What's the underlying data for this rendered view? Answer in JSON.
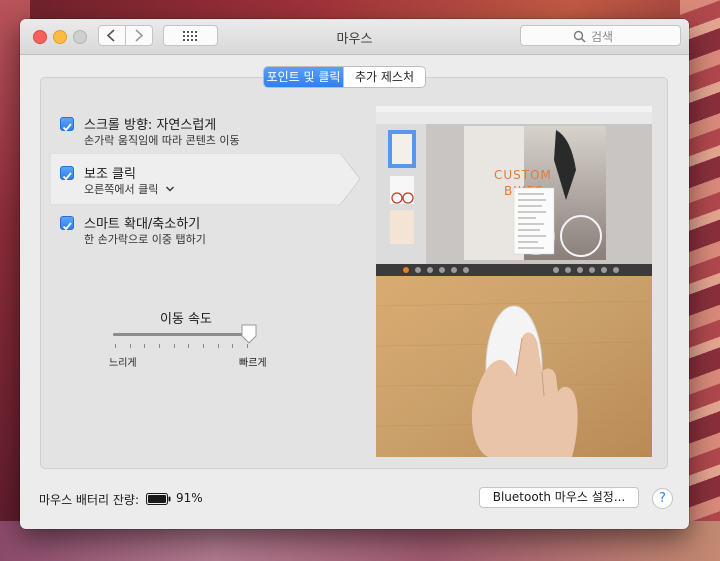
{
  "window": {
    "title": "마우스",
    "search_placeholder": "검색"
  },
  "tabs": [
    {
      "label": "포인트 및 클릭",
      "active": true
    },
    {
      "label": "추가 제스처",
      "active": false
    }
  ],
  "options": [
    {
      "title": "스크롤 방향: 자연스럽게",
      "subtitle": "손가락 움직임에 따라 콘텐츠 이동",
      "checked": true
    },
    {
      "title": "보조 클릭",
      "subtitle": "오른쪽에서 클릭",
      "checked": true,
      "selected": true
    },
    {
      "title": "스마트 확대/축소하기",
      "subtitle": "한 손가락으로 이중 탭하기",
      "checked": true
    }
  ],
  "tracking_speed": {
    "label": "이동 속도",
    "min_label": "느리게",
    "max_label": "빠르게",
    "value_fraction": 1.0
  },
  "preview": {
    "screen_heading_line1": "CUSTOM",
    "screen_heading_line2": "BIKES"
  },
  "footer": {
    "battery_label": "마우스 배터리 잔량:",
    "battery_value": "91%",
    "bluetooth_button": "Bluetooth 마우스 설정...",
    "help": "?"
  },
  "colors": {
    "accent": "#2f7ff0"
  },
  "icons": {
    "nav_back": "chevron-left-icon",
    "nav_forward": "chevron-right-icon",
    "show_all": "grid-icon",
    "search": "magnifier-icon",
    "battery": "battery-icon",
    "disclosure": "chevron-down-icon"
  }
}
